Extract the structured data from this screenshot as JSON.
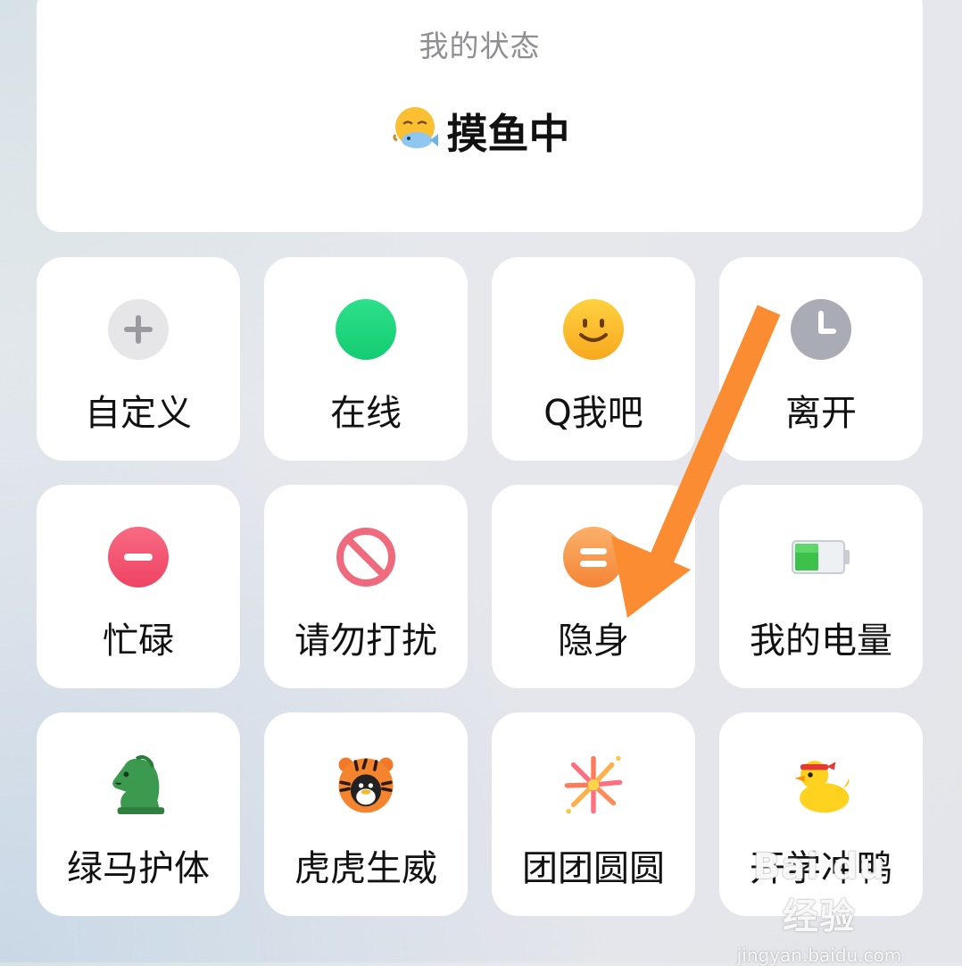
{
  "status_card": {
    "label": "我的状态",
    "icon": "fishing-emoji-icon",
    "value": "摸鱼中"
  },
  "tiles": [
    {
      "label": "自定义",
      "icon": "plus-icon"
    },
    {
      "label": "在线",
      "icon": "online-dot-icon"
    },
    {
      "label": "Q我吧",
      "icon": "smile-icon"
    },
    {
      "label": "离开",
      "icon": "clock-icon"
    },
    {
      "label": "忙碌",
      "icon": "minus-circle-icon"
    },
    {
      "label": "请勿打扰",
      "icon": "no-entry-icon"
    },
    {
      "label": "隐身",
      "icon": "equals-circle-icon"
    },
    {
      "label": "我的电量",
      "icon": "battery-icon"
    },
    {
      "label": "绿马护体",
      "icon": "green-horse-icon"
    },
    {
      "label": "虎虎生威",
      "icon": "tiger-icon"
    },
    {
      "label": "团团圆圆",
      "icon": "firework-icon"
    },
    {
      "label": "开学冲鸭",
      "icon": "duck-icon"
    }
  ],
  "watermark": {
    "main": "Bai du 经验",
    "sub": "jingyan.baidu.com"
  },
  "colors": {
    "online": "#1fd77c",
    "smile": "#fbbd2a",
    "clock": "#a9abb5",
    "busy": "#f25470",
    "dnd": "#ee6a7c",
    "invisible": "#f6984a",
    "arrow": "#fb8c32"
  }
}
